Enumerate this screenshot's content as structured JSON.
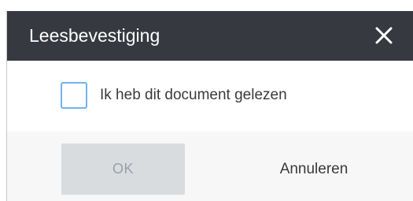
{
  "dialog": {
    "title": "Leesbevestiging",
    "close_icon": "close-icon",
    "checkbox": {
      "label": "Ik heb dit document gelezen",
      "checked": false,
      "border_color": "#6fb3f0"
    },
    "buttons": {
      "ok_label": "OK",
      "ok_enabled": false,
      "cancel_label": "Annuleren"
    },
    "colors": {
      "header_bg": "#363a40",
      "header_text": "#ffffff",
      "footer_bg": "#f7f7f7",
      "ok_disabled_bg": "#d9dcdf",
      "ok_disabled_text": "#9aa0a6"
    }
  }
}
